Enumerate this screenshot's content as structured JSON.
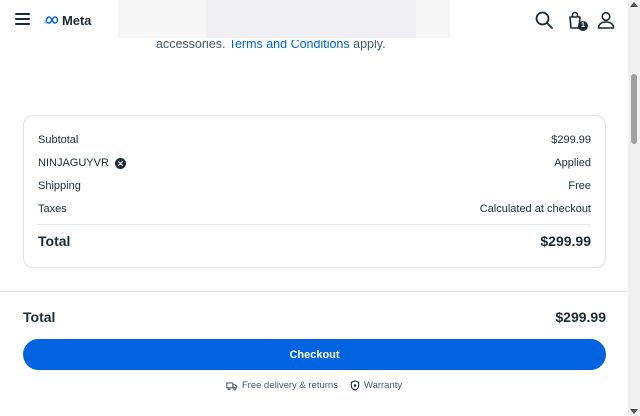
{
  "header": {
    "logo_text": "Meta",
    "menu_icon": "hamburger-menu-icon",
    "search_icon": "search-icon",
    "cart_icon": "shopping-bag-icon",
    "cart_count": "1",
    "account_icon": "user-icon"
  },
  "terms": {
    "prefix": "accessories.",
    "link": "Terms and Conditions",
    "suffix": "apply."
  },
  "summary": {
    "subtotal_label": "Subtotal",
    "subtotal_value": "$299.99",
    "promo_code": "NINJAGUYVR",
    "promo_remove_icon": "close-circle-icon",
    "promo_status": "Applied",
    "shipping_label": "Shipping",
    "shipping_value": "Free",
    "taxes_label": "Taxes",
    "taxes_value": "Calculated at checkout",
    "total_label": "Total",
    "total_value": "$299.99"
  },
  "checkout_bar": {
    "total_label": "Total",
    "total_value": "$299.99",
    "button_label": "Checkout",
    "perks": [
      {
        "icon": "delivery-truck-icon",
        "label": "Free delivery & returns"
      },
      {
        "icon": "shield-icon",
        "label": "Warranty"
      }
    ]
  },
  "colors": {
    "accent": "#0064e0",
    "text": "#1c2b33",
    "muted": "#465a69",
    "border": "#dfe3e7"
  }
}
